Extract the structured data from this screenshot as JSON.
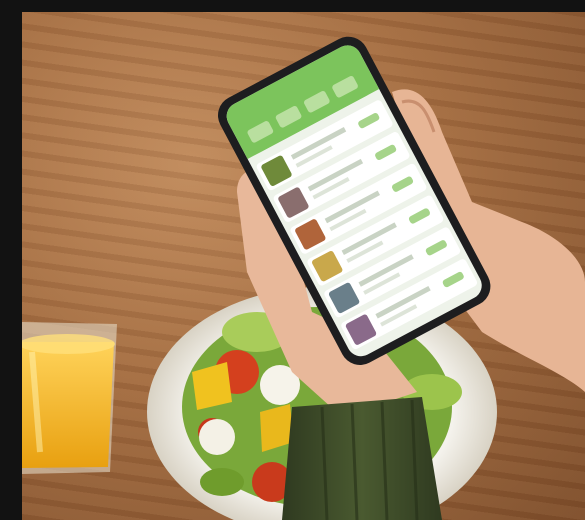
{
  "scene": {
    "phone_rows": [
      {
        "thumb_color": "#6f8a3a"
      },
      {
        "thumb_color": "#8a6e6e"
      },
      {
        "thumb_color": "#b0643a"
      },
      {
        "thumb_color": "#c9a84b"
      },
      {
        "thumb_color": "#6a7f8a"
      },
      {
        "thumb_color": "#8a6a8a"
      }
    ],
    "colors": {
      "app_header": "#7cc45c",
      "app_body": "#eef3ea",
      "phone_frame": "#1d1d1f",
      "juice": "#f2b320",
      "bowl": "#f2f0ea",
      "sleeve": "#3d4a2a",
      "table": "#a26b40"
    }
  }
}
